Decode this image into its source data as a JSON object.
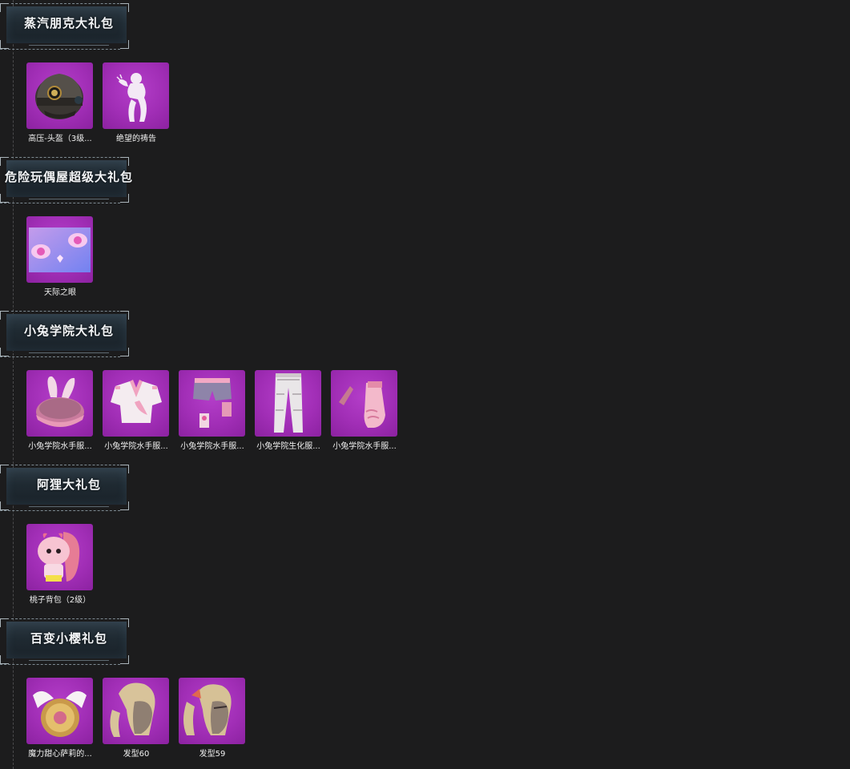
{
  "packs": [
    {
      "title": "蒸汽朋克大礼包",
      "items": [
        {
          "label": "高压-头盔（3级...",
          "icon": "helmet-icon"
        },
        {
          "label": "绝望的祷告",
          "icon": "emote-prayer-icon"
        }
      ]
    },
    {
      "title": "危险玩偶屋超级大礼包",
      "items": [
        {
          "label": "天际之眼",
          "icon": "sky-eye-icon"
        }
      ]
    },
    {
      "title": "小兔学院大礼包",
      "items": [
        {
          "label": "小兔学院水手服...",
          "icon": "bunny-helmet-icon"
        },
        {
          "label": "小兔学院水手服...",
          "icon": "sailor-top-icon"
        },
        {
          "label": "小兔学院水手服...",
          "icon": "sailor-shorts-icon"
        },
        {
          "label": "小兔学院生化服...",
          "icon": "hazmat-pants-icon"
        },
        {
          "label": "小兔学院水手服...",
          "icon": "gloves-icon"
        }
      ]
    },
    {
      "title": "阿狸大礼包",
      "items": [
        {
          "label": "桃子背包（2级）",
          "icon": "peach-backpack-icon"
        }
      ]
    },
    {
      "title": "百变小樱礼包",
      "items": [
        {
          "label": "魔力甜心萨莉的...",
          "icon": "winged-shield-icon"
        },
        {
          "label": "发型60",
          "icon": "hairstyle-icon"
        },
        {
          "label": "发型59",
          "icon": "hairstyle-icon"
        }
      ]
    }
  ],
  "colors": {
    "background": "#1c1c1d",
    "tile": "#a12eb6",
    "header": "#1f2a32"
  }
}
